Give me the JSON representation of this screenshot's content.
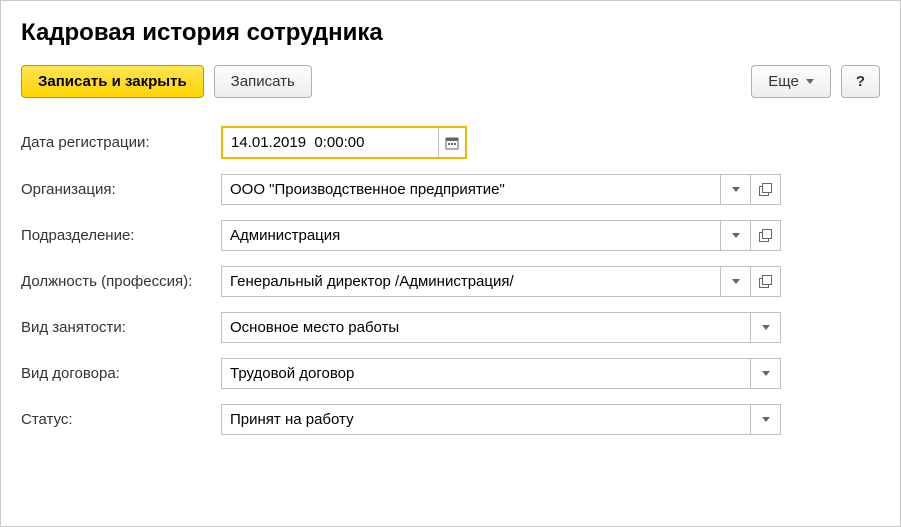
{
  "title": "Кадровая история сотрудника",
  "toolbar": {
    "save_close_label": "Записать и закрыть",
    "save_label": "Записать",
    "more_label": "Еще",
    "help_label": "?"
  },
  "fields": {
    "reg_date": {
      "label": "Дата регистрации:",
      "value": "14.01.2019  0:00:00"
    },
    "organization": {
      "label": "Организация:",
      "value": "ООО \"Производственное предприятие\""
    },
    "department": {
      "label": "Подразделение:",
      "value": "Администрация"
    },
    "position": {
      "label": "Должность (профессия):",
      "value": "Генеральный директор /Администрация/"
    },
    "employment_type": {
      "label": "Вид занятости:",
      "value": "Основное место работы"
    },
    "contract_type": {
      "label": "Вид договора:",
      "value": "Трудовой договор"
    },
    "status": {
      "label": "Статус:",
      "value": "Принят на работу"
    }
  }
}
